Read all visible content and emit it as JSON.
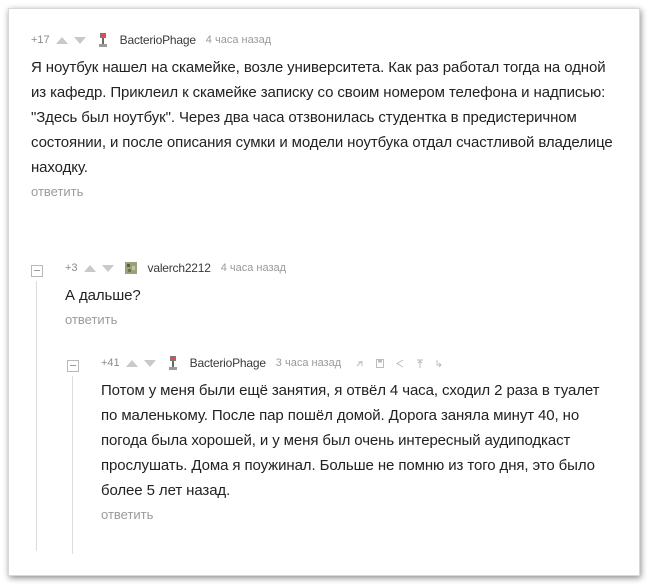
{
  "comments": [
    {
      "rating": "+17",
      "author": "BacterioPhage",
      "time": "4 часа назад",
      "text": "Я ноутбук нашел на скамейке, возле университета. Как раз работал тогда на одной из кафедр. Приклеил к скамейке записку со своим номером телефона и надписью: \"Здесь был ноутбук\". Через два часа отзвонилась студентка в предистеричном состоянии, и после описания сумки и модели ноутбука отдал счастливой владелице находку.",
      "reply": "ответить"
    },
    {
      "rating": "+3",
      "author": "valerch2212",
      "time": "4 часа назад",
      "text": "А дальше?",
      "reply": "ответить"
    },
    {
      "rating": "+41",
      "author": "BacterioPhage",
      "time": "3 часа назад",
      "text": "Потом у меня были ещё занятия, я отвёл 4 часа, сходил 2 раза в туалет по маленькому. После пар пошёл домой. Дорога заняла минут 40, но погода была хорошей, и у меня был очень интересный аудиподкаст прослушать. Дома я поужинал. Больше не помню из того дня, это было более 5 лет назад.",
      "reply": "ответить"
    }
  ],
  "colors": {
    "text": "#222222",
    "muted": "#9b9b9b",
    "vote": "#c9c9c9"
  },
  "icons": [
    "link-icon",
    "save-icon",
    "share-icon",
    "to-top-icon",
    "to-parent-icon"
  ]
}
